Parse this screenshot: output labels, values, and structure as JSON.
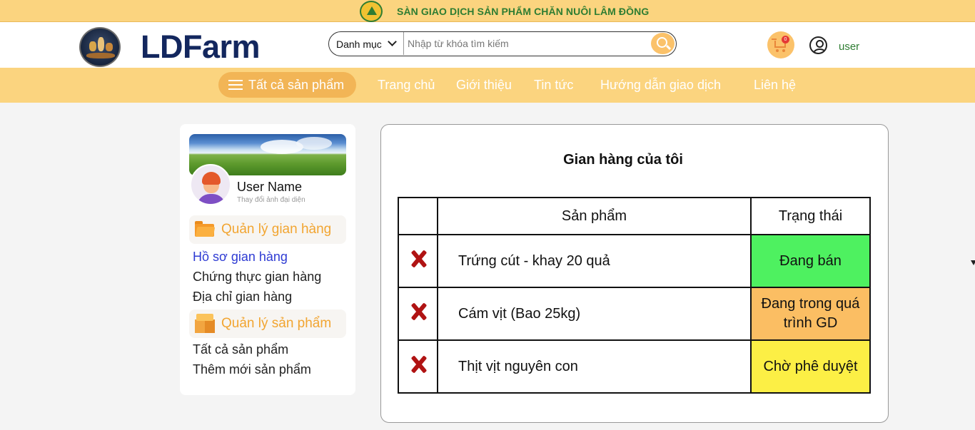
{
  "banner": {
    "title": "SÀN GIAO DỊCH SẢN PHẨM CHĂN NUÔI LÂM ĐỒNG",
    "seal_icon": "green-mountain-seal"
  },
  "header": {
    "logo_text": "LDFarm",
    "search": {
      "category_label": "Danh mục",
      "placeholder": "Nhập từ khóa tìm kiếm"
    },
    "cart_count": "0",
    "user_label": "user"
  },
  "nav": {
    "all_products": "Tất cả sản phẩm",
    "links": [
      "Trang chủ",
      "Giới thiệu",
      "Tin tức",
      "Hướng dẫn giao dịch",
      "Liên hệ"
    ]
  },
  "sidebar": {
    "user_name": "User Name",
    "change_avatar": "Thay đổi ảnh đại diện",
    "groups": [
      {
        "label": "Quản lý gian hàng",
        "icon": "folder-icon",
        "items": [
          "Hồ sơ gian hàng",
          "Chứng thực gian hàng",
          "Địa chỉ gian hàng"
        ]
      },
      {
        "label": "Quản lý sản phẩm",
        "icon": "box-icon",
        "items": [
          "Tất cả sản phẩm",
          "Thêm mới sản phẩm"
        ]
      }
    ],
    "active_item": "Hồ sơ gian hàng"
  },
  "main": {
    "title": "Gian hàng của tôi",
    "table": {
      "headers": [
        "",
        "Sản phẩm",
        "Trạng thái"
      ],
      "rows": [
        {
          "product": "Trứng cút - khay  20 quả",
          "status": "Đang bán",
          "status_color": "#4ef160"
        },
        {
          "product": "Cám vịt (Bao 25kg)",
          "status": "Đang trong quá trình GD",
          "status_color": "#fbbe63"
        },
        {
          "product": "Thịt vịt nguyên con",
          "status": "Chờ phê duyệt",
          "status_color": "#fcef45"
        }
      ]
    }
  },
  "colors": {
    "banner": "#fbd47f",
    "nav": "#fbd47f",
    "accent": "#f2a531",
    "logo": "#13275e",
    "delete": "#b01313"
  }
}
